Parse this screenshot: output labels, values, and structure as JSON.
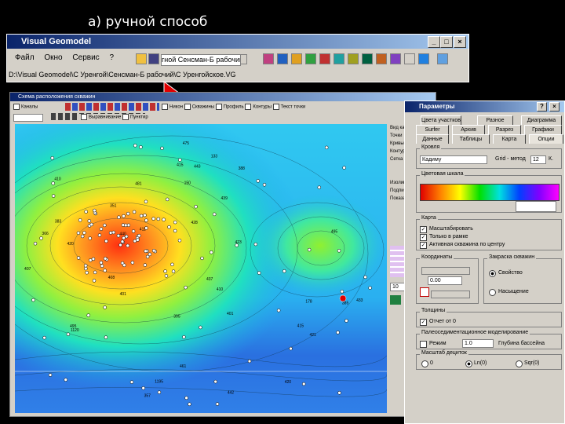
{
  "slide": {
    "title": "а) ручной способ"
  },
  "main_window": {
    "title": "Visual Geomodel",
    "menu": [
      "Файл",
      "Окно",
      "Сервис",
      "?"
    ],
    "project_combo": "гной Сенсман-Б рабочий",
    "path": "D:\\Visual Geomodel\\С Уренгой\\Сенсман-Б рабочий\\С Уренгойское.VG"
  },
  "map_window": {
    "title": "Схема расположения скважин",
    "row1_checks": [
      "Никон",
      "Скважины",
      "Профиль",
      "Контуры",
      "Текст точки"
    ],
    "row1_first": "Каналы",
    "row2_checks": [
      "Выравнивание",
      "Пунктир"
    ],
    "side_labels": [
      "Вид карты",
      "Точки",
      "Кривые",
      "Контуры",
      "Сетка",
      "Изолинии",
      "Подписи",
      "Показать"
    ],
    "side_value": "10",
    "wells": [
      "1120",
      "442",
      "440",
      "481",
      "385",
      "415",
      "401",
      "495",
      "433",
      "411",
      "410",
      "420",
      "421",
      "437",
      "423",
      "410",
      "1195",
      "420",
      "461",
      "415",
      "495",
      "351",
      "366",
      "357",
      "178",
      "133",
      "150",
      "428",
      "408",
      "439",
      "401",
      "443",
      "407",
      "475",
      "388",
      "383",
      "395"
    ]
  },
  "params": {
    "title": "Параметры",
    "tabs_row1": [
      "Цвета участков",
      "Разное",
      "Диаграмма"
    ],
    "tabs_row2": [
      "Surfer",
      "Архив",
      "Разрез",
      "Графики"
    ],
    "tabs_row3": [
      "Данные",
      "Таблицы",
      "Карта",
      "Опции"
    ],
    "section_roof": "Кровля",
    "roof_value": "Кадиму",
    "grid_method_label": "Grid - метод",
    "grid_method_value": "12",
    "k_label": "К.",
    "color_scale_label": "Цветовая шкала",
    "map_label": "Карта",
    "map_checks": [
      "Масштабировать",
      "Только в рамке",
      "Активная скважина по центру"
    ],
    "coords_label": "Координаты",
    "coord_value": "0.00",
    "fill_label": "Закраска скважин",
    "fill_opts": [
      "Свойство",
      "Насыщение"
    ],
    "thickness_label": "Толщины",
    "thickness_check": "Отчет от 0",
    "paleo_label": "Палеоседиментационное моделирование",
    "paleo_check": "Режим",
    "paleo_value": "1.0",
    "paleo_depth": "Глубина бассейна",
    "scale_label": "Масштаб дециток",
    "scale_opts": [
      "0",
      "Ln(0)",
      "Sqr(0)"
    ]
  },
  "colors": {
    "title_start": "#0a246a",
    "title_end": "#a6caf0",
    "pointer": "#e00000",
    "window_bg": "#d4d0c8"
  }
}
